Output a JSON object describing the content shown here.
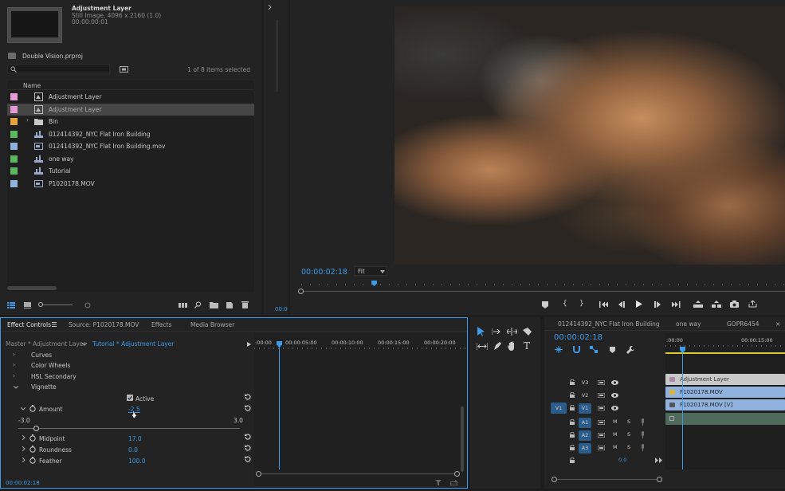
{
  "project": {
    "clip_title": "Adjustment Layer",
    "clip_info": "Still Image, 4096 x 2160 (1.0)",
    "clip_duration": "00:00:00:01",
    "project_file": "Double Vision.prproj",
    "search_placeholder": "",
    "items_selected": "1 of 8 items selected",
    "column_name": "Name",
    "items": [
      {
        "label": "Adjustment Layer",
        "color": "#e59ad8",
        "icon": "adjustment-layer-icon"
      },
      {
        "label": "Adjustment Layer",
        "color": "#e59ad8",
        "icon": "adjustment-layer-icon"
      },
      {
        "label": "Bin",
        "color": "#e3a43a",
        "icon": "folder-icon"
      },
      {
        "label": "012414392_NYC Flat Iron Building",
        "color": "#5cb85c",
        "icon": "sequence-icon"
      },
      {
        "label": "012414392_NYC Flat Iron Building.mov",
        "color": "#8fb3de",
        "icon": "video-clip-icon"
      },
      {
        "label": "one way",
        "color": "#5cb85c",
        "icon": "sequence-icon"
      },
      {
        "label": "Tutorial",
        "color": "#5cb85c",
        "icon": "sequence-icon"
      },
      {
        "label": "P1020178.MOV",
        "color": "#8fb3de",
        "icon": "video-clip-icon"
      }
    ]
  },
  "source_strip": {
    "timecode": "00:0"
  },
  "program": {
    "timecode": "00:00:02:18",
    "fit_label": "Fit",
    "playhead_fraction": 0.15
  },
  "effect_controls": {
    "tabs": [
      "Effect Controls",
      "Source: P1020178.MOV",
      "Effects",
      "Media Browser"
    ],
    "master_label": "Master * Adjustment Layer",
    "clip_label": "Tutorial * Adjustment Layer",
    "ruler": [
      ":00:00",
      "00:00:05:00",
      "00:00:10:00",
      "00:00:15:00",
      "00:00:20:00"
    ],
    "effects": [
      "Curves",
      "Color Wheels",
      "HSL Secondary",
      "Vignette"
    ],
    "active_label": "Active",
    "amount": {
      "label": "Amount",
      "value": "-2.5",
      "min": "-3.0",
      "max": "3.0",
      "level_fraction": 0.08
    },
    "midpoint": {
      "label": "Midpoint",
      "value": "17.0"
    },
    "roundness": {
      "label": "Roundness",
      "value": "0.0"
    },
    "feather": {
      "label": "Feather",
      "value": "100.0"
    },
    "footer_timecode": "00:00:02:18"
  },
  "timeline": {
    "tabs": [
      "012414392_NYC Flat Iron Building",
      "one way",
      "GOPR6454"
    ],
    "timecode": "00:00:02:18",
    "ruler": [
      ":00:00",
      "00:00:15:00"
    ],
    "tracks": {
      "v3": "V3",
      "v2": "V2",
      "v1": "V1",
      "a1": "A1",
      "a2": "A2",
      "a3": "A3",
      "src_v1": "V1"
    },
    "mute": "M",
    "solo": "S",
    "audio_level": "0.0",
    "clips": {
      "v3": "Adjustment Layer",
      "v2": "P1020178.MOV",
      "v1": "P1020178.MOV [V]"
    }
  },
  "colors": {
    "accent": "#3d9bea",
    "panel": "#232323",
    "selection": "#464646"
  }
}
